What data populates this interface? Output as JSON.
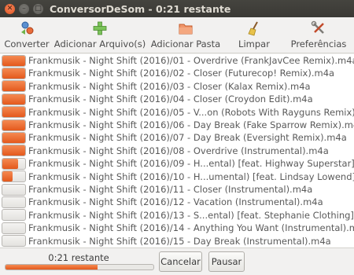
{
  "window": {
    "title": "ConversorDeSom - 0:21 restante"
  },
  "toolbar": {
    "items": [
      {
        "label": "Converter",
        "icon": "convert-icon"
      },
      {
        "label": "Adicionar Arquivo(s)",
        "icon": "add-file-icon"
      },
      {
        "label": "Adicionar Pasta",
        "icon": "folder-icon"
      },
      {
        "label": "Limpar",
        "icon": "broom-icon"
      },
      {
        "label": "Preferências",
        "icon": "tools-icon"
      }
    ]
  },
  "files": [
    {
      "name": "Frankmusik - Night Shift (2016)/01 - Overdrive (FrankJavCee Remix).m4a",
      "progress": 1.0
    },
    {
      "name": "Frankmusik - Night Shift (2016)/02 - Closer (Futurecop! Remix).m4a",
      "progress": 1.0
    },
    {
      "name": "Frankmusik - Night Shift (2016)/03 - Closer (Kalax Remix).m4a",
      "progress": 1.0
    },
    {
      "name": "Frankmusik - Night Shift (2016)/04 - Closer (Croydon Edit).m4a",
      "progress": 1.0
    },
    {
      "name": "Frankmusik - Night Shift (2016)/05 - V...on (Robots With Rayguns Remix).m4a",
      "progress": 1.0
    },
    {
      "name": "Frankmusik - Night Shift (2016)/06 - Day Break (Fake Sparrow Remix).m4a",
      "progress": 1.0
    },
    {
      "name": "Frankmusik - Night Shift (2016)/07 - Day Break (Eversight Remix).m4a",
      "progress": 1.0
    },
    {
      "name": "Frankmusik - Night Shift (2016)/08 - Overdrive (Instrumental).m4a",
      "progress": 1.0
    },
    {
      "name": "Frankmusik - Night Shift (2016)/09 - H...ental) [feat. Highway Superstar].m4a",
      "progress": 0.7
    },
    {
      "name": "Frankmusik - Night Shift (2016)/10 - H...umental) [feat. Lindsay Lowend].m4a",
      "progress": 0.45
    },
    {
      "name": "Frankmusik - Night Shift (2016)/11 - Closer (Instrumental).m4a",
      "progress": 0
    },
    {
      "name": "Frankmusik - Night Shift (2016)/12 - Vacation (Instrumental).m4a",
      "progress": 0
    },
    {
      "name": "Frankmusik - Night Shift (2016)/13 - S...ental) [feat. Stephanie Clothing].m4a",
      "progress": 0
    },
    {
      "name": "Frankmusik - Night Shift (2016)/14 - Anything You Want (Instrumental).m4a",
      "progress": 0
    },
    {
      "name": "Frankmusik - Night Shift (2016)/15 - Day Break (Instrumental).m4a",
      "progress": 0
    }
  ],
  "status": {
    "text": "0:21 restante",
    "progress": 0.62
  },
  "buttons": {
    "cancel": "Cancelar",
    "pause": "Pausar"
  },
  "colors": {
    "accent": "#e85e23",
    "titlebar": "#3c3b37"
  }
}
